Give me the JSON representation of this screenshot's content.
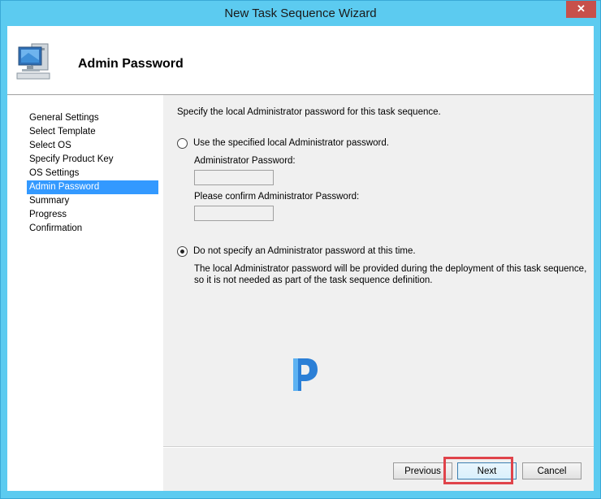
{
  "window": {
    "title": "New Task Sequence Wizard",
    "close_label": "✕"
  },
  "header": {
    "page_title": "Admin Password",
    "icon": "computer-icon"
  },
  "sidebar": {
    "items": [
      {
        "label": "General Settings",
        "active": false
      },
      {
        "label": "Select Template",
        "active": false
      },
      {
        "label": "Select OS",
        "active": false
      },
      {
        "label": "Specify Product Key",
        "active": false
      },
      {
        "label": "OS Settings",
        "active": false
      },
      {
        "label": "Admin Password",
        "active": true
      },
      {
        "label": "Summary",
        "active": false
      },
      {
        "label": "Progress",
        "active": false
      },
      {
        "label": "Confirmation",
        "active": false
      }
    ]
  },
  "main": {
    "intro": "Specify the local Administrator password for this task sequence.",
    "option_specify": {
      "label": "Use the specified local Administrator password.",
      "selected": false
    },
    "admin_password": {
      "label": "Administrator Password:",
      "value": ""
    },
    "confirm_password": {
      "label": "Please confirm Administrator Password:",
      "value": ""
    },
    "option_none": {
      "label": "Do not specify an Administrator password at this time.",
      "selected": true,
      "description": "The local Administrator password will be provided during the deployment of this task sequence, so it is not needed as part of the task sequence definition."
    },
    "watermark_icon": "p-logo-icon"
  },
  "buttons": {
    "previous": "Previous",
    "next": "Next",
    "cancel": "Cancel"
  },
  "colors": {
    "titlebar": "#5ccbf0",
    "selection": "#3399ff",
    "close": "#c7504b",
    "highlight": "#e0434a"
  }
}
